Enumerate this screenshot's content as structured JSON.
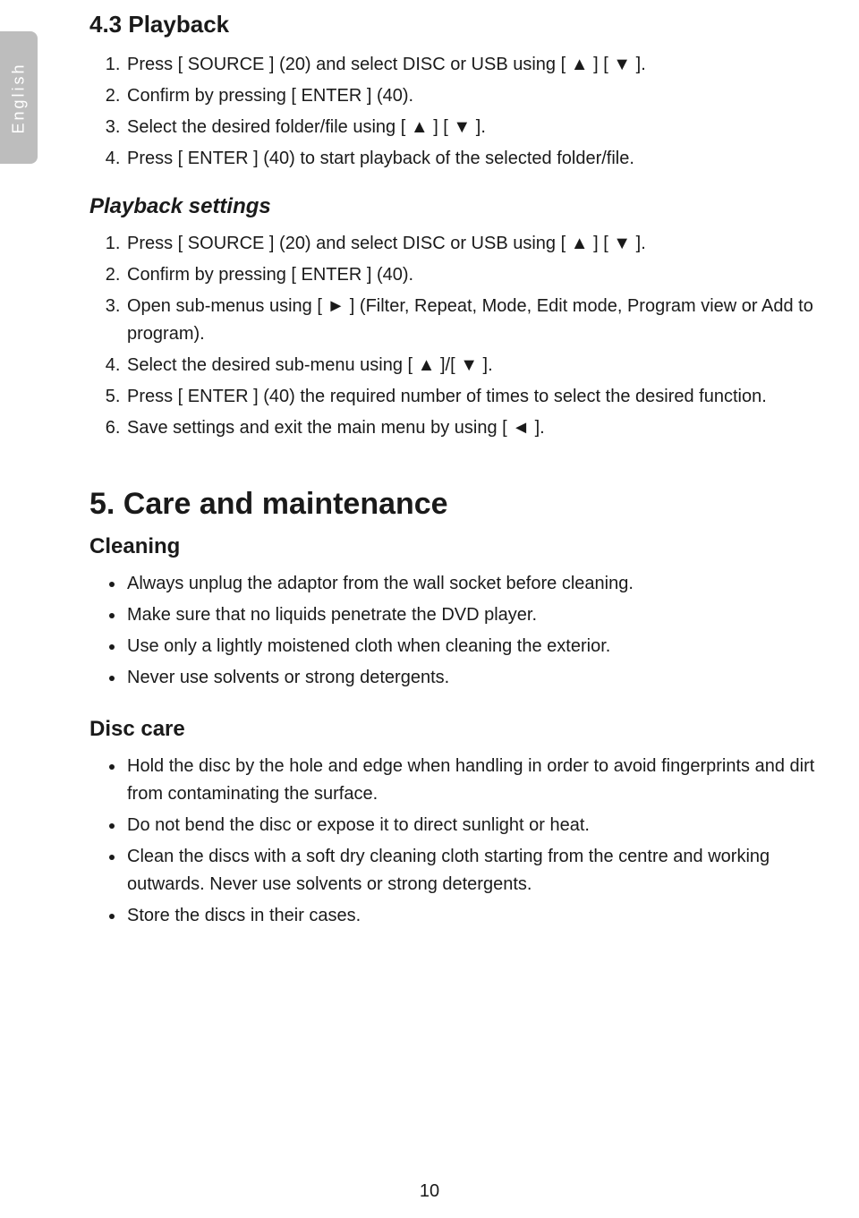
{
  "language_tab": "English",
  "section_4_3": {
    "title": "4.3 Playback",
    "steps": [
      "Press [ SOURCE ] (20) and select DISC or USB using [ ▲ ] [ ▼ ].",
      "Confirm by pressing [ ENTER ] (40).",
      "Select the desired folder/file using [ ▲ ] [ ▼ ].",
      "Press [ ENTER ] (40) to start playback of the selected folder/file."
    ],
    "subsection_title": "Playback settings",
    "sub_steps": [
      "Press [ SOURCE ] (20) and select DISC or USB using [ ▲ ] [ ▼ ].",
      "Confirm by pressing [ ENTER ] (40).",
      "Open sub-menus using [ ► ] (Filter, Repeat, Mode, Edit mode, Program view or Add to program).",
      "Select the desired sub-menu using [ ▲ ]/[ ▼ ].",
      "Press [ ENTER ] (40) the required number of times to select the desired function.",
      "Save settings and exit the main menu by using [ ◄ ]."
    ]
  },
  "section_5": {
    "title": "5. Care and maintenance",
    "cleaning_title": "Cleaning",
    "cleaning_items": [
      "Always unplug the adaptor from the wall socket before cleaning.",
      "Make sure that no liquids penetrate the DVD player.",
      "Use only a lightly moistened cloth when cleaning the exterior.",
      "Never use solvents or strong detergents."
    ],
    "disc_care_title": "Disc care",
    "disc_care_items": [
      "Hold the disc by the hole and edge when handling in order to avoid fingerprints and dirt from contaminating the surface.",
      "Do not bend the disc or expose it to direct sunlight or heat.",
      "Clean the discs with a soft dry cleaning cloth starting from the centre and working outwards. Never use solvents or strong detergents.",
      "Store the discs in their cases."
    ]
  },
  "page_number": "10"
}
